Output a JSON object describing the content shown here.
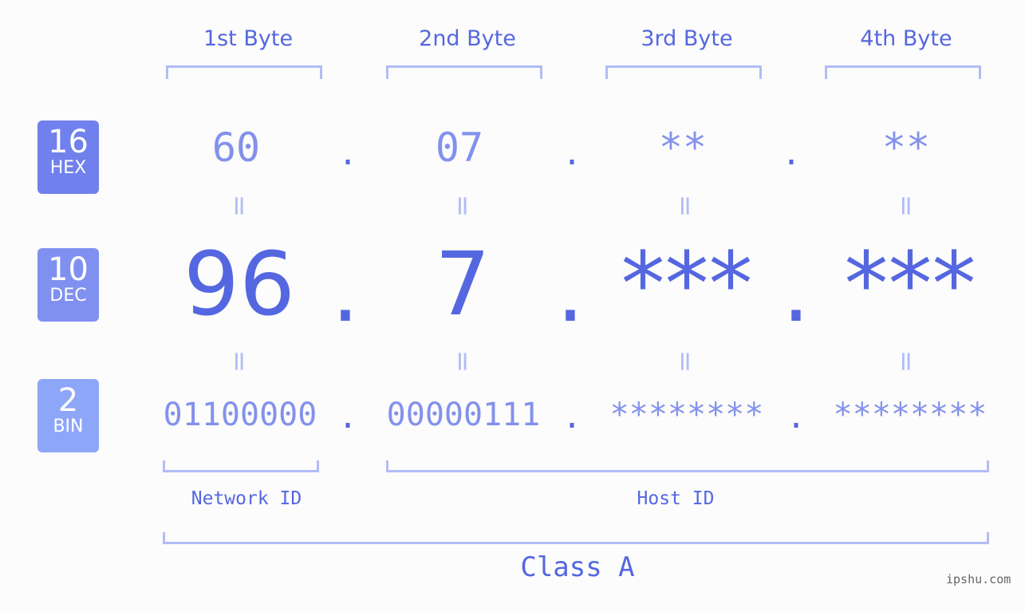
{
  "bytes": [
    {
      "label": "1st Byte",
      "hex": "60",
      "dec": "96",
      "bin": "01100000"
    },
    {
      "label": "2nd Byte",
      "hex": "07",
      "dec": "7",
      "bin": "00000111"
    },
    {
      "label": "3rd Byte",
      "hex": "**",
      "dec": "***",
      "bin": "********"
    },
    {
      "label": "4th Byte",
      "hex": "**",
      "dec": "***",
      "bin": "********"
    }
  ],
  "bases": {
    "hex": {
      "num": "16",
      "unit": "HEX",
      "color": "#7080ec"
    },
    "dec": {
      "num": "10",
      "unit": "DEC",
      "color": "#8090f0"
    },
    "bin": {
      "num": "2",
      "unit": "BIN",
      "color": "#8ea6f8"
    }
  },
  "separator": ".",
  "equals": "=",
  "network_id_label": "Network ID",
  "host_id_label": "Host ID",
  "class_label": "Class A",
  "watermark": "ipshu.com"
}
